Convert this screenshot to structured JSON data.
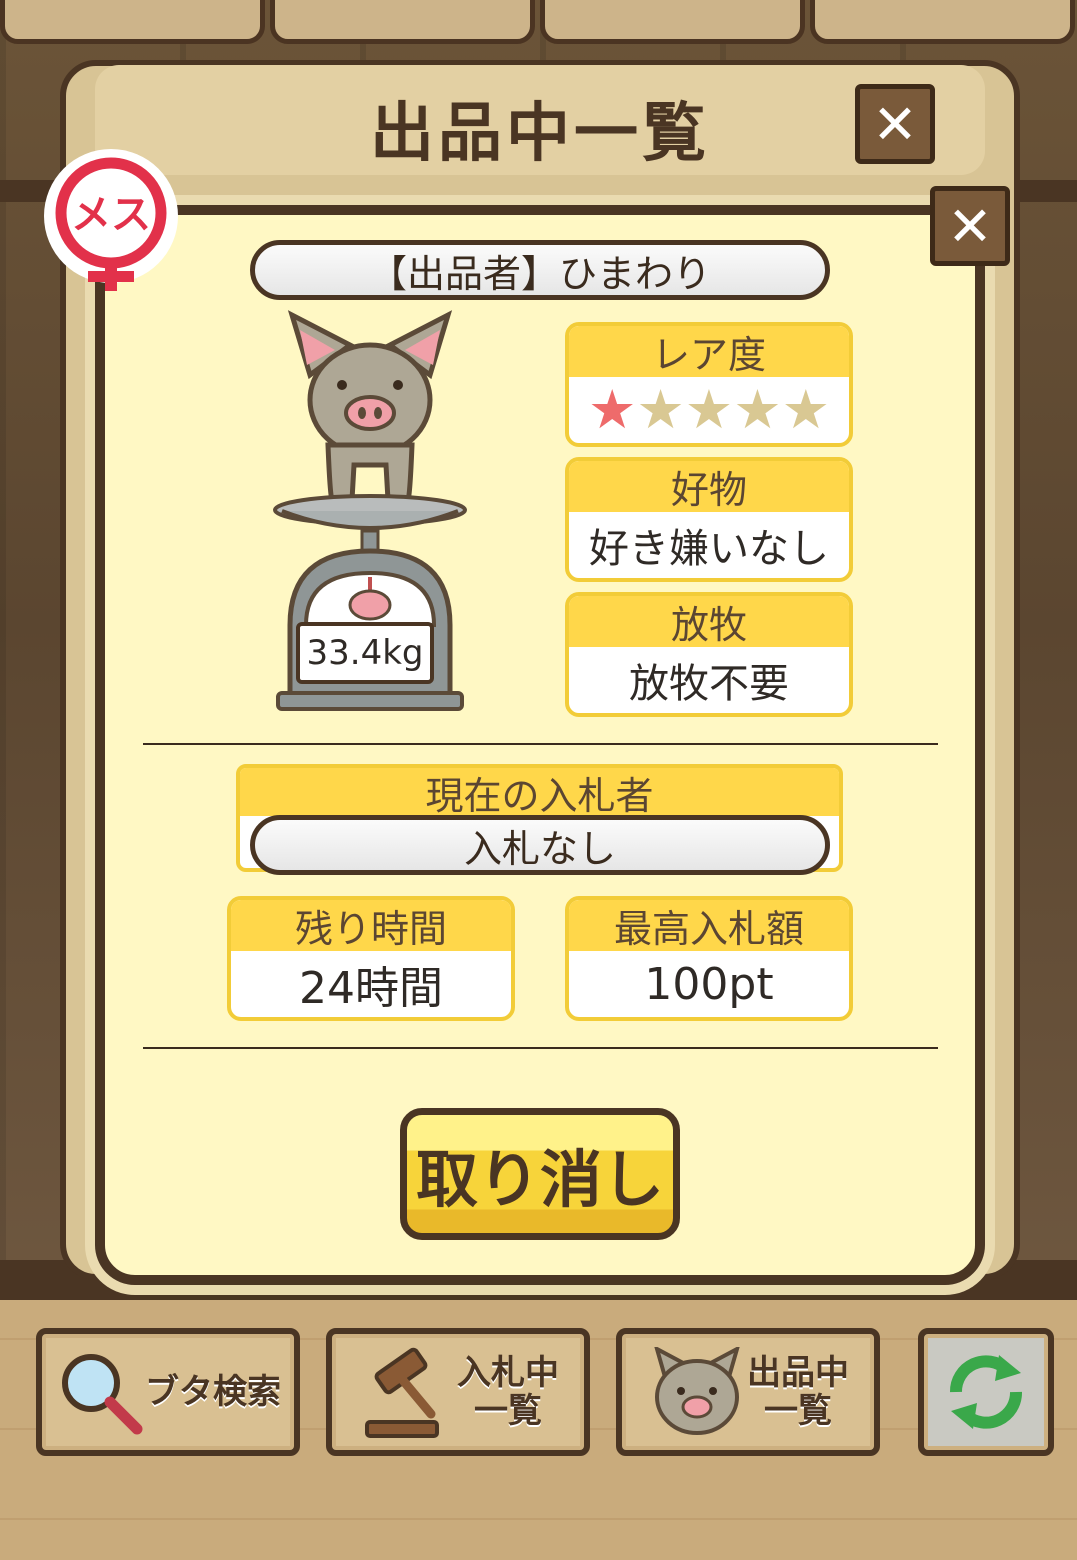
{
  "header": {
    "title": "出品中一覧"
  },
  "listing": {
    "seller_label": "【出品者】ひまわり",
    "sex_badge": "メス",
    "weight": "33.4kg",
    "rarity": {
      "label": "レア度",
      "filled": 1,
      "total": 5,
      "filled_color": "#ee6b6b",
      "empty_color": "#d9c893"
    },
    "favorite": {
      "label": "好物",
      "value": "好き嫌いなし"
    },
    "grazing": {
      "label": "放牧",
      "value": "放牧不要"
    },
    "bidder": {
      "label": "現在の入札者",
      "value": "入札なし"
    },
    "time_left": {
      "label": "残り時間",
      "value": "24時間"
    },
    "highest_bid": {
      "label": "最高入札額",
      "value": "100pt"
    },
    "cancel_label": "取り消し"
  },
  "nav": [
    {
      "label": "ブタ検索",
      "icon": "magnifier-icon"
    },
    {
      "label": "入札中\n一覧",
      "icon": "gavel-icon"
    },
    {
      "label": "出品中\n一覧",
      "icon": "pig-face-icon"
    },
    {
      "label": "",
      "icon": "refresh-icon"
    }
  ],
  "colors": {
    "accent": "#ffd74a",
    "frame": "#4a3523",
    "panel": "#fff8c4",
    "badge": "#e2314a"
  }
}
